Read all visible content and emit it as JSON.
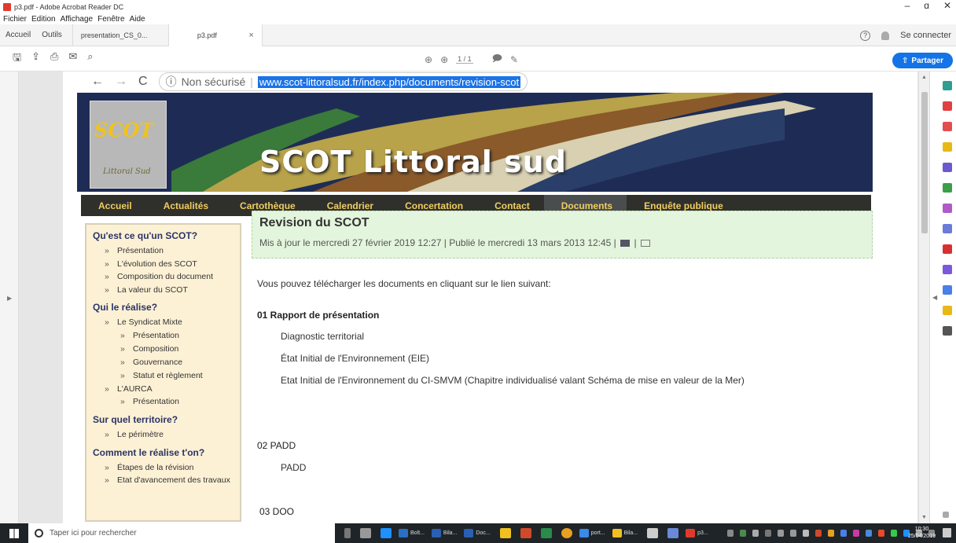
{
  "window": {
    "title": "p3.pdf - Adobe Acrobat Reader DC",
    "controls": [
      "–",
      "ɑ",
      "✕"
    ]
  },
  "menu": [
    "Fichier",
    "Edition",
    "Affichage",
    "Fenêtre",
    "Aide"
  ],
  "tabs": {
    "home": "Accueil",
    "tools": "Outils",
    "documents": [
      {
        "label": "presentation_CS_0...",
        "active": false
      },
      {
        "label": "p3.pdf",
        "active": true,
        "close": "×"
      }
    ],
    "signin": "Se connecter"
  },
  "toolbar": {
    "page_current": "1",
    "page_total": "/ 1",
    "share_label": "Partager",
    "share_color": "#1473e6"
  },
  "browser": {
    "nav": [
      "←",
      "→",
      "C"
    ],
    "insecure_label": "Non sécurisé",
    "url": "www.scot-littoralsud.fr/index.php/documents/revision-scot"
  },
  "site": {
    "logo_text": "SCOT",
    "logo_sub": "Littoral Sud",
    "title": "SCOT Littoral sud",
    "nav": [
      {
        "label": "Accueil",
        "active": false
      },
      {
        "label": "Actualités",
        "active": false
      },
      {
        "label": "Cartothèque",
        "active": false
      },
      {
        "label": "Calendrier",
        "active": false
      },
      {
        "label": "Concertation",
        "active": false
      },
      {
        "label": "Contact",
        "active": false
      },
      {
        "label": "Documents",
        "active": true
      },
      {
        "label": "Enquête publique",
        "active": false
      }
    ],
    "sidebar": {
      "h1": "Qu'est ce qu'un SCOT?",
      "s1": [
        "Présentation",
        "L'évolution des SCOT",
        "Composition du document",
        "La valeur du SCOT"
      ],
      "h2": "Qui le réalise?",
      "syndicat": "Le Syndicat Mixte",
      "syndicat_sub": [
        "Présentation",
        "Composition",
        "Gouvernance",
        "Statut et règlement"
      ],
      "aurca": "L'AURCA",
      "aurca_sub": [
        "Présentation"
      ],
      "h3": "Sur quel territoire?",
      "s3": [
        "Le périmètre"
      ],
      "h4": "Comment le réalise t'on?",
      "s4": [
        "Étapes de la révision",
        "Etat d'avancement des travaux"
      ]
    },
    "article": {
      "title": "Revision du SCOT",
      "meta": "Mis à jour le mercredi 27 février 2019 12:27 | Publié le mercredi 13 mars 2013 12:45 |",
      "intro": "Vous pouvez télécharger les documents en cliquant sur le lien suivant:",
      "sec1_title": "01 Rapport de présentation",
      "sec1_items": [
        "Diagnostic territorial",
        "État Initial de l'Environnement (EIE)",
        "Etat Initial de l'Environnement du CI-SMVM (Chapitre individualisé valant Schéma de mise en valeur de la Mer)"
      ],
      "sec2_title": "02 PADD",
      "sec2_items": [
        "PADD"
      ],
      "sec3_title": "03 DOO"
    }
  },
  "taskbar": {
    "search_placeholder": "Taper ici pour rechercher",
    "items": [
      "Bolt...",
      "Bila...",
      "Doc...",
      "port...",
      "Bila...",
      "p3..."
    ],
    "time": "10:30",
    "date": "25/04/2019"
  }
}
